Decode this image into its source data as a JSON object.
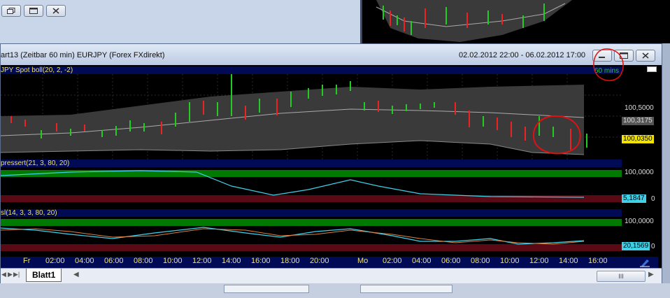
{
  "colors": {
    "chart_bg": "#000000",
    "header_bg": "#000a55",
    "header_text": "#f0e068",
    "up_bar": "#22cc22",
    "down_bar": "#ee2222",
    "band": "#3a3a3a",
    "osc_line": "#40d0e8",
    "osc_line2": "#e08040",
    "green_zone": "#007a00",
    "red_zone": "#5a0a14",
    "annotation": "#e01010"
  },
  "window": {
    "title": "art13 (Zeitbar 60 min)  EURJPY (Forex FXdirekt)",
    "date_range": "02.02.2012 22:00 - 06.02.2012 17:00",
    "controls": [
      "minimize",
      "maximize",
      "close"
    ]
  },
  "price_pane": {
    "header": "JPY Spot boll(20, 2, -2)",
    "interval_badge": "60 mins",
    "axis_labels": [
      "100,5000",
      "100,3175",
      "100,0350"
    ],
    "current_value": "100,0350",
    "band_mid_value": "100,3175"
  },
  "osc1_pane": {
    "header": "pressert(21, 3, 80, 20)",
    "axis_top": "100,0000",
    "axis_bottom": "0",
    "current_value": "5,1847"
  },
  "osc2_pane": {
    "header": "sl(14, 3, 3, 80, 20)",
    "axis_top": "100,0000",
    "axis_bottom": "0",
    "current_value": "20,1569"
  },
  "time_axis": [
    "Fr",
    "02:00",
    "04:00",
    "06:00",
    "08:00",
    "10:00",
    "12:00",
    "14:00",
    "16:00",
    "18:00",
    "20:00",
    "Mo",
    "02:00",
    "04:00",
    "06:00",
    "08:00",
    "10:00",
    "12:00",
    "14:00",
    "16:00"
  ],
  "tabs": {
    "active": "Blatt1",
    "scroll_grip": "III"
  }
}
